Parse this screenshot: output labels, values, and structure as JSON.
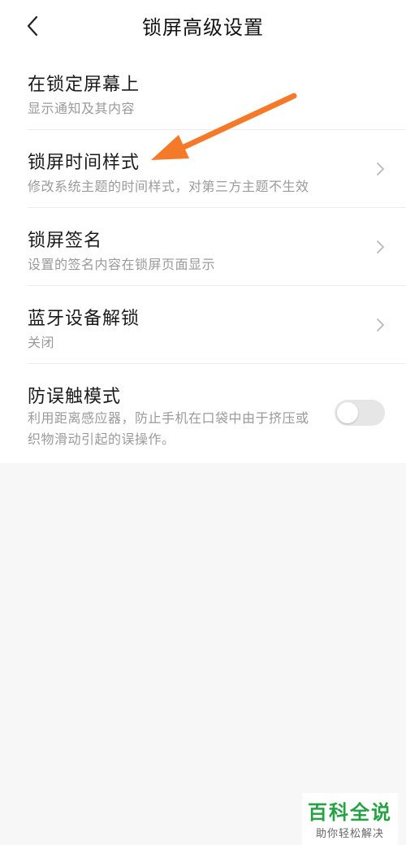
{
  "header": {
    "title": "锁屏高级设置"
  },
  "settings": {
    "items": [
      {
        "title": "在锁定屏幕上",
        "subtitle": "显示通知及其内容"
      },
      {
        "title": "锁屏时间样式",
        "subtitle": "修改系统主题的时间样式，对第三方主题不生效"
      },
      {
        "title": "锁屏签名",
        "subtitle": "设置的签名内容在锁屏页面显示"
      },
      {
        "title": "蓝牙设备解锁",
        "subtitle": "关闭"
      },
      {
        "title": "防误触模式",
        "subtitle": "利用距离感应器，防止手机在口袋中由于挤压或织物滑动引起的误操作。",
        "toggle_on": false
      }
    ]
  },
  "annotation": {
    "arrow_color": "#f47a2a"
  },
  "watermark": {
    "main": "百科全说",
    "sub": "助你轻松解决",
    "color": "#25a244"
  }
}
